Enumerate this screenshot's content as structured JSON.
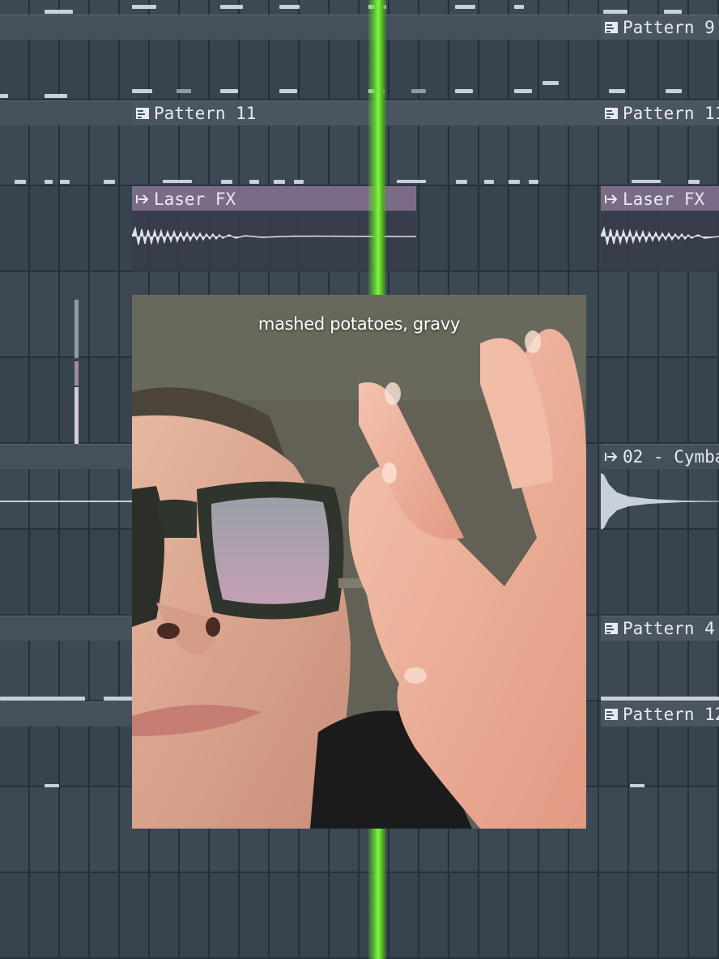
{
  "app": {
    "name": ""
  },
  "tracks": [
    {
      "row": 0
    },
    {
      "row": 1,
      "clips": [
        {
          "label": "Pattern 9",
          "type": "pattern"
        }
      ]
    },
    {
      "row": 2,
      "clips": [
        {
          "label": "Pattern 11",
          "type": "pattern"
        },
        {
          "label": "Pattern 11",
          "type": "pattern"
        }
      ]
    },
    {
      "row": 3,
      "clips": [
        {
          "label": "Laser FX",
          "type": "audio"
        },
        {
          "label": "Laser FX",
          "type": "audio"
        }
      ]
    },
    {
      "row": 4
    },
    {
      "row": 5,
      "clips": [
        {
          "label": "02 - Cymba",
          "type": "audio"
        }
      ]
    },
    {
      "row": 6,
      "clips": [
        {
          "label": "Pattern 4",
          "type": "pattern"
        }
      ]
    },
    {
      "row": 7,
      "clips": [
        {
          "label": "Pattern 12",
          "type": "pattern"
        }
      ]
    }
  ],
  "video": {
    "caption": "mashed potatoes, gravy"
  },
  "colors": {
    "playhead": "#5fd42a",
    "pattern_header": "#4a5561",
    "audio_header": "#7a6b86",
    "track_bg": "#3c4853"
  },
  "icons": {
    "pattern": "piano-roll-icon",
    "audio": "audio-arrow-icon"
  }
}
